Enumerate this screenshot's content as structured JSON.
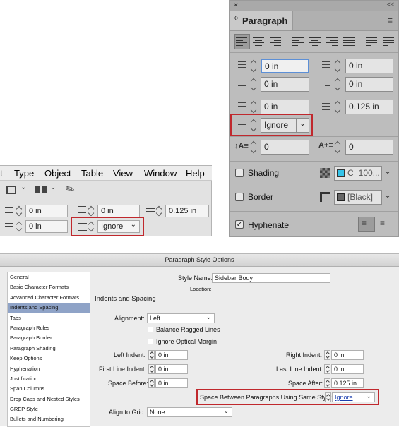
{
  "menubar": {
    "items": [
      "t",
      "Type",
      "Object",
      "Table",
      "View",
      "Window",
      "Help"
    ]
  },
  "control_panel": {
    "space_after_label": "0 in",
    "first_line_label": "0 in",
    "space_before": "0 in",
    "space_after": "0.125 in",
    "last_line": "0 in",
    "same_style": "Ignore"
  },
  "paragraph_panel": {
    "close_glyph": "✕",
    "collapse_glyph": "<<",
    "title": "Paragraph",
    "left_indent": "0 in",
    "right_indent": "0 in",
    "first_line_indent": "0 in",
    "last_line_indent": "0 in",
    "space_before": "0 in",
    "space_after": "0.125 in",
    "same_style": "Ignore",
    "drop_cap_lines": "0",
    "drop_cap_chars": "0",
    "shading_label": "Shading",
    "shading_color": "C=100...",
    "shading_swatch": "#35c4ea",
    "border_label": "Border",
    "border_color": "[Black]",
    "hyphenate_label": "Hyphenate",
    "hyphenate_checked": true
  },
  "dialog": {
    "title": "Paragraph Style Options",
    "style_name_label": "Style Name:",
    "style_name": "Sidebar Body",
    "location_label": "Location:",
    "section_title": "Indents and Spacing",
    "sidebar": [
      "General",
      "Basic Character Formats",
      "Advanced Character Formats",
      "Indents and Spacing",
      "Tabs",
      "Paragraph Rules",
      "Paragraph Border",
      "Paragraph Shading",
      "Keep Options",
      "Hyphenation",
      "Justification",
      "Span Columns",
      "Drop Caps and Nested Styles",
      "GREP Style",
      "Bullets and Numbering"
    ],
    "selected_index": 3,
    "alignment_label": "Alignment:",
    "alignment": "Left",
    "balance_label": "Balance Ragged Lines",
    "optical_label": "Ignore Optical Margin",
    "left_indent_label": "Left Indent:",
    "left_indent": "0 in",
    "first_line_label": "First Line Indent:",
    "first_line": "0 in",
    "space_before_label": "Space Before:",
    "space_before": "0 in",
    "right_indent_label": "Right Indent:",
    "right_indent": "0 in",
    "last_line_label": "Last Line Indent:",
    "last_line": "0 in",
    "space_after_label": "Space After:",
    "space_after": "0.125 in",
    "same_style_label": "Space Between Paragraphs Using Same Style:",
    "same_style": "Ignore",
    "grid_label": "Align to Grid:",
    "grid": "None"
  },
  "colors": {
    "highlight": "#c0282d",
    "selection": "#8fa3c7"
  }
}
